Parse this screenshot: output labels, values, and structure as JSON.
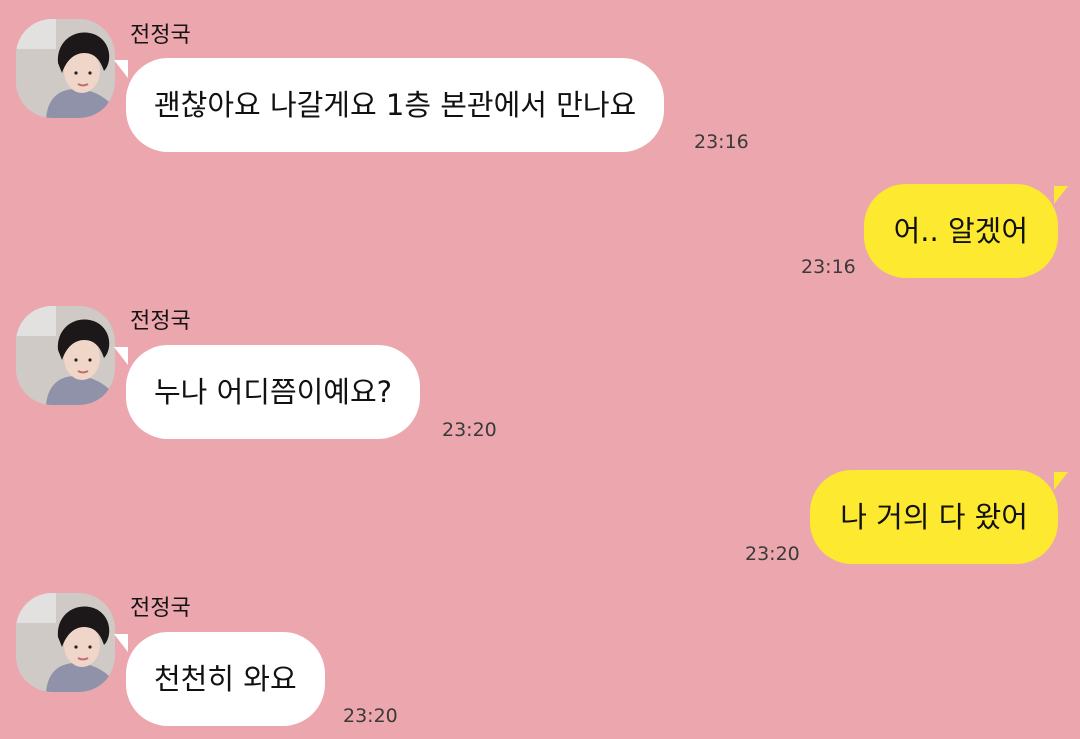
{
  "theme": {
    "background": "#eca7ae",
    "incoming_bubble": "#ffffff",
    "outgoing_bubble": "#fde92f"
  },
  "messages": [
    {
      "direction": "in",
      "sender": "전정국",
      "avatar_icon": "profile-photo",
      "text": "괜찮아요 나갈게요 1층 본관에서 만나요",
      "time": "23:16"
    },
    {
      "direction": "out",
      "text": "어.. 알겠어",
      "time": "23:16"
    },
    {
      "direction": "in",
      "sender": "전정국",
      "avatar_icon": "profile-photo",
      "text": "누나 어디쯤이예요?",
      "time": "23:20"
    },
    {
      "direction": "out",
      "text": "나 거의 다 왔어",
      "time": "23:20"
    },
    {
      "direction": "in",
      "sender": "전정국",
      "avatar_icon": "profile-photo",
      "text": "천천히 와요",
      "time": "23:20"
    }
  ]
}
